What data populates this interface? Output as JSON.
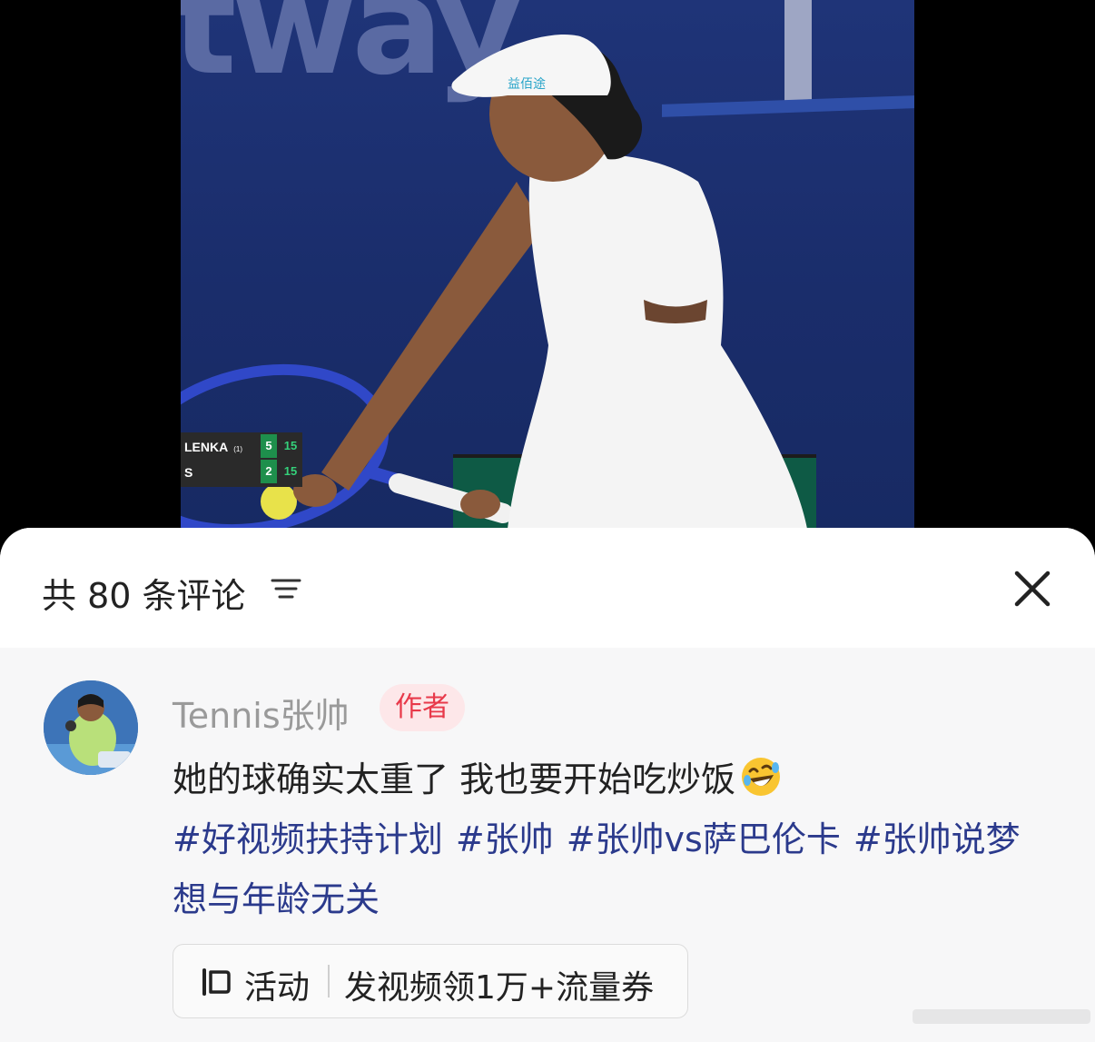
{
  "video": {
    "wall_text": "tway",
    "scoreboard": {
      "player1_name": "LENKA",
      "player1_seed": "(1)",
      "player1_sets": "5",
      "player1_points": "15",
      "player2_name": "S",
      "player2_sets": "2",
      "player2_points": "15"
    },
    "cap_text": "益佰途"
  },
  "comments_panel": {
    "count_label": "共 80 条评论",
    "filter_icon": "filter-icon",
    "close_icon": "close-icon"
  },
  "comment": {
    "username": "Tennis张帅",
    "author_badge": "作者",
    "text": "她的球确实太重了 我也要开始吃炒饭",
    "emoji": "rolling-on-floor-laughing",
    "hashtags": [
      "#好视频扶持计划",
      "#张帅",
      "#张帅vs萨巴伦卡",
      "#张帅说梦想与年龄无关"
    ],
    "activity": {
      "icon": "activity-icon",
      "label": "活动",
      "text": "发视频领1万+流量券"
    }
  },
  "colors": {
    "hashtag": "#2b3a8c",
    "badge_bg": "#fde7e9",
    "badge_text": "#e8394a",
    "username": "#9a9a9a",
    "sheet_bg": "#f7f7f8"
  }
}
